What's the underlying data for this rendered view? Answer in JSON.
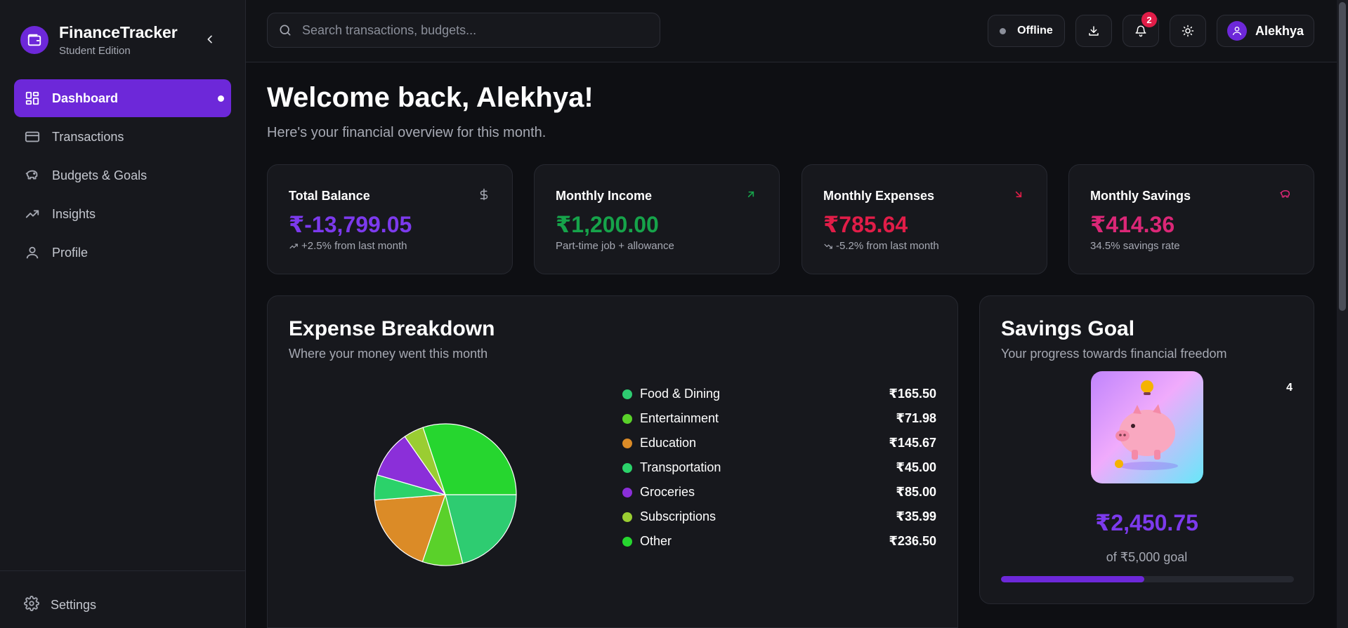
{
  "app": {
    "title": "FinanceTracker",
    "edition": "Student Edition"
  },
  "sidebar": {
    "items": [
      {
        "label": "Dashboard",
        "icon": "dashboard-icon",
        "active": true
      },
      {
        "label": "Transactions",
        "icon": "card-icon"
      },
      {
        "label": "Budgets & Goals",
        "icon": "piggy-bank-icon"
      },
      {
        "label": "Insights",
        "icon": "trending-up-icon"
      },
      {
        "label": "Profile",
        "icon": "user-icon"
      }
    ],
    "settings_label": "Settings"
  },
  "topbar": {
    "search_placeholder": "Search transactions, budgets...",
    "status_label": "Offline",
    "notification_count": "2",
    "user_name": "Alekhya"
  },
  "welcome": {
    "title": "Welcome back, Alekhya!",
    "subtitle": "Here's your financial overview for this month."
  },
  "stats": [
    {
      "title": "Total Balance",
      "value": "₹-13,799.05",
      "sub": "+2.5% from last month",
      "color": "#7c3aed",
      "icon": "dollar-icon"
    },
    {
      "title": "Monthly Income",
      "value": "₹1,200.00",
      "sub": "Part-time job + allowance",
      "color": "#16a34a",
      "icon": "arrow-up-right-icon"
    },
    {
      "title": "Monthly Expenses",
      "value": "₹785.64",
      "sub": "-5.2% from last month",
      "color": "#e11d48",
      "icon": "arrow-down-right-icon"
    },
    {
      "title": "Monthly Savings",
      "value": "₹414.36",
      "sub": "34.5% savings rate",
      "color": "#db2777",
      "icon": "piggy-bank-icon"
    }
  ],
  "expense": {
    "title": "Expense Breakdown",
    "subtitle": "Where your money went this month"
  },
  "chart_data": {
    "type": "pie",
    "categories": [
      "Food & Dining",
      "Entertainment",
      "Education",
      "Transportation",
      "Groceries",
      "Subscriptions",
      "Other"
    ],
    "values": [
      165.5,
      71.98,
      145.67,
      45.0,
      85.0,
      35.99,
      236.5
    ],
    "value_labels": [
      "₹165.50",
      "₹71.98",
      "₹145.67",
      "₹45.00",
      "₹85.00",
      "₹35.99",
      "₹236.50"
    ],
    "colors": [
      "#2ecc71",
      "#5ad12a",
      "#db8b27",
      "#2bd26a",
      "#8b2fd9",
      "#9acd32",
      "#26d62f"
    ]
  },
  "savings": {
    "title": "Savings Goal",
    "subtitle": "Your progress towards financial freedom",
    "count": "4",
    "amount": "₹2,450.75",
    "goal_text": "of ₹5,000 goal",
    "progress": 0.49
  }
}
